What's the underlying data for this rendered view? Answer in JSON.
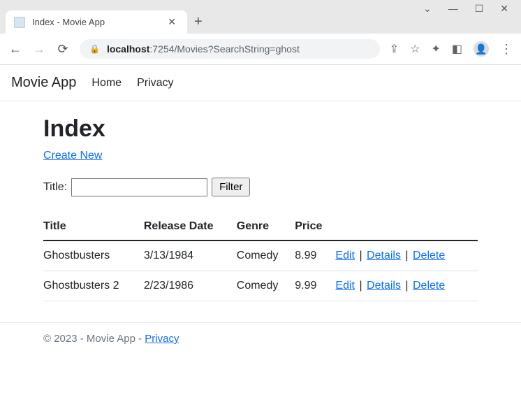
{
  "browser": {
    "tab_title": "Index - Movie App",
    "url_host": "localhost",
    "url_rest": ":7254/Movies?SearchString=ghost"
  },
  "navbar": {
    "brand": "Movie App",
    "links": [
      "Home",
      "Privacy"
    ]
  },
  "page_title": "Index",
  "create_label": "Create New",
  "filter": {
    "label": "Title:",
    "input_value": "",
    "button_label": "Filter"
  },
  "table": {
    "headers": [
      "Title",
      "Release Date",
      "Genre",
      "Price",
      ""
    ],
    "rows": [
      {
        "title": "Ghostbusters",
        "release_date": "3/13/1984",
        "genre": "Comedy",
        "price": "8.99"
      },
      {
        "title": "Ghostbusters 2",
        "release_date": "2/23/1986",
        "genre": "Comedy",
        "price": "9.99"
      }
    ],
    "actions": {
      "edit": "Edit",
      "details": "Details",
      "delete": "Delete"
    }
  },
  "footer": {
    "text": "© 2023 - Movie App - ",
    "privacy_label": "Privacy"
  }
}
